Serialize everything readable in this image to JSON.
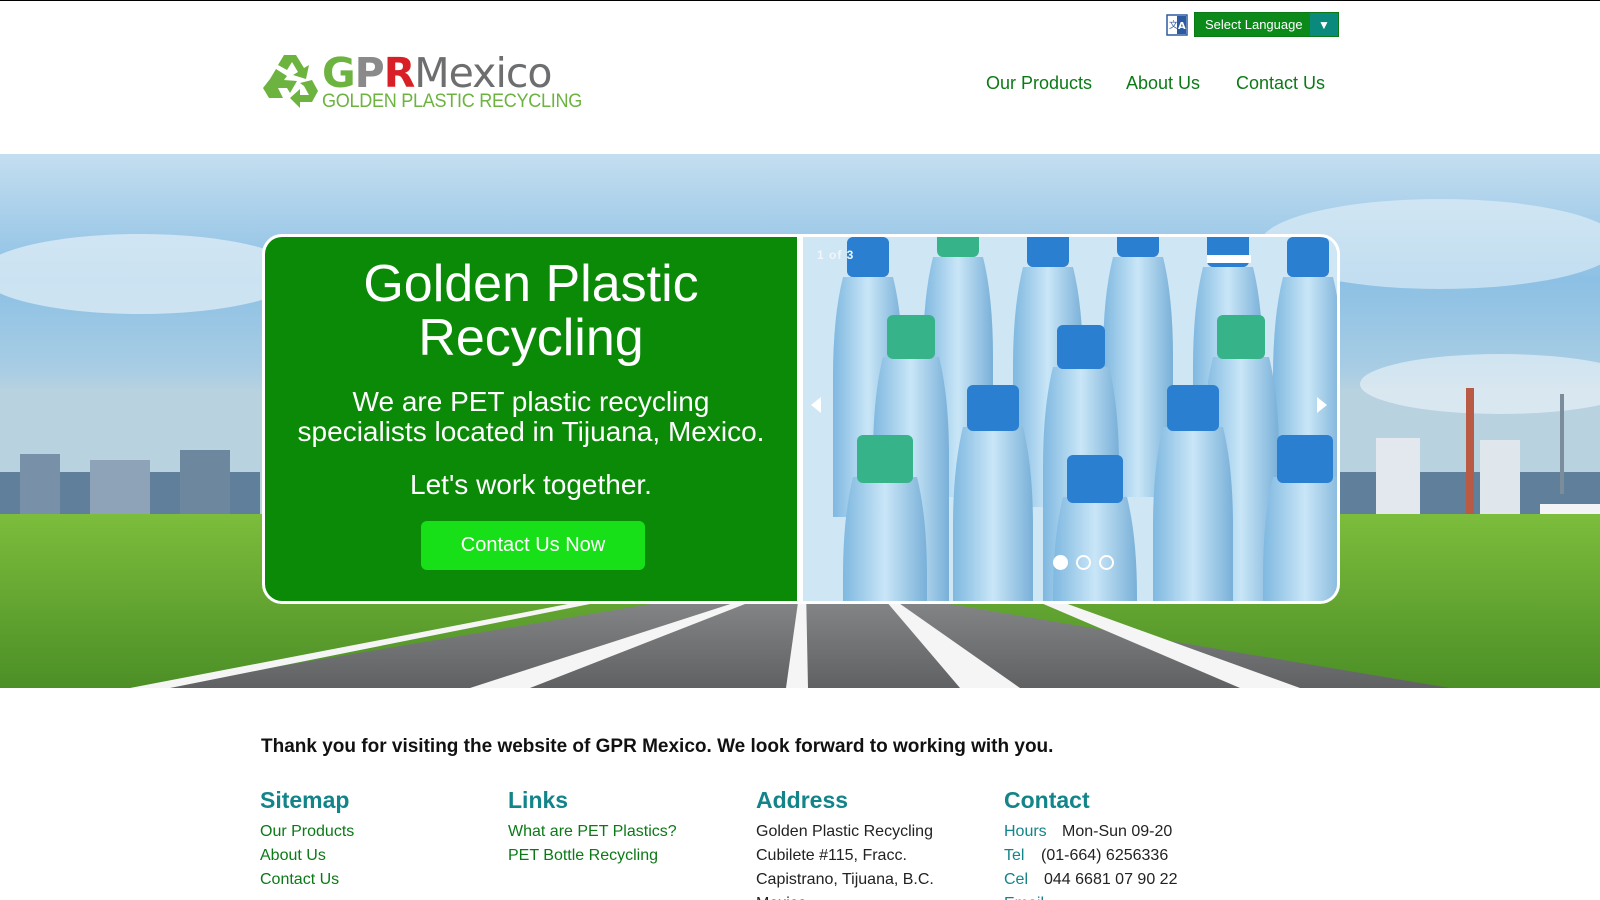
{
  "header": {
    "logo": {
      "g": "G",
      "p": "P",
      "r": "R",
      "rest": "Mexico",
      "subtitle": "GOLDEN PLASTIC RECYCLING"
    },
    "language_select": "Select Language",
    "nav": [
      "Our Products",
      "About Us",
      "Contact Us"
    ]
  },
  "hero": {
    "title_line1": "Golden Plastic",
    "title_line2": "Recycling",
    "subtitle_line1": "We are PET plastic recycling",
    "subtitle_line2": "specialists located in Tijuana, Mexico.",
    "tagline": "Let's work together.",
    "cta": "Contact Us Now",
    "slider": {
      "counter": "1 of 3",
      "slide_count": 3,
      "active_index": 0
    }
  },
  "main": {
    "thanks": "Thank you for visiting the website of GPR Mexico. We look forward to working with you."
  },
  "footer": {
    "sitemap": {
      "title": "Sitemap",
      "links": [
        "Our Products",
        "About Us",
        "Contact Us"
      ]
    },
    "links": {
      "title": "Links",
      "links": [
        "What are PET Plastics?",
        "PET Bottle Recycling"
      ]
    },
    "address": {
      "title": "Address",
      "lines": [
        "Golden Plastic Recycling",
        "Cubilete #115, Fracc.",
        "Capistrano, Tijuana, B.C.",
        "Mexico"
      ]
    },
    "contact": {
      "title": "Contact",
      "hours_label": "Hours",
      "hours": "Mon-Sun 09-20",
      "tel_label": "Tel",
      "tel": "(01-664) 6256336",
      "cel_label": "Cel",
      "cel": "044 6681 07 90 22",
      "email_label": "Email"
    }
  },
  "colors": {
    "brand_green": "#0a8a07",
    "cta_green": "#18e018",
    "heading_teal": "#12848a",
    "link_green": "#0b7a16"
  }
}
